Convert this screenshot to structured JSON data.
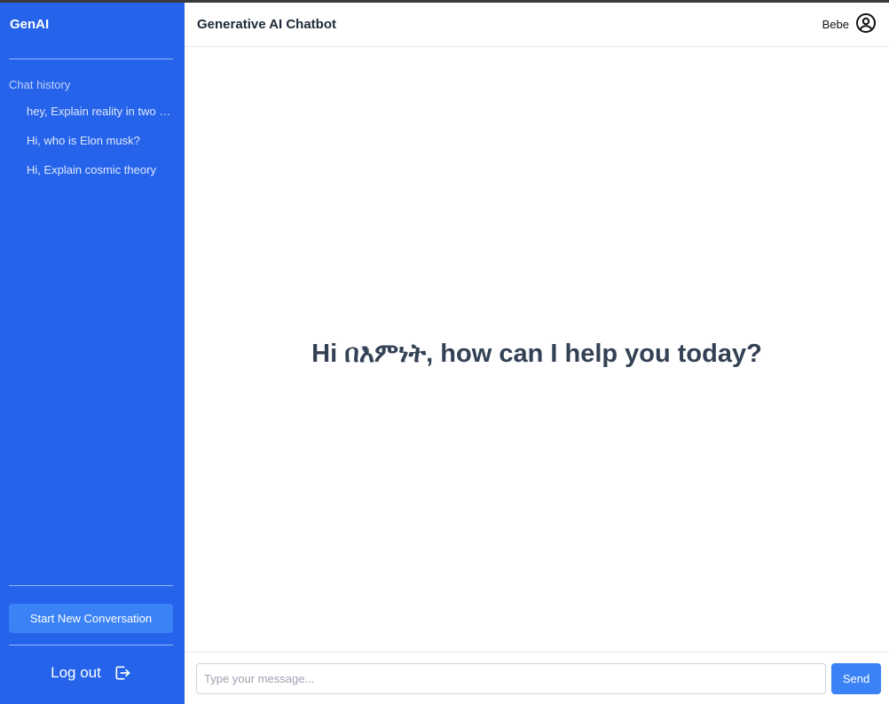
{
  "sidebar": {
    "brand": "GenAI",
    "history_title": "Chat history",
    "history": [
      "hey, Explain reality in two lines",
      "Hi, who is Elon musk?",
      "Hi, Explain cosmic theory"
    ],
    "new_conversation_label": "Start New Conversation",
    "logout_label": "Log out"
  },
  "header": {
    "title": "Generative AI Chatbot",
    "username": "Bebe"
  },
  "main": {
    "greeting": "Hi በእምነት, how can I help you today?"
  },
  "composer": {
    "placeholder": "Type your message...",
    "send_label": "Send"
  },
  "icons": {
    "user": "user-circle-icon",
    "logout": "logout-icon"
  },
  "colors": {
    "sidebar_bg": "#2563eb",
    "accent": "#3b82f6",
    "greeting_text": "#334155"
  }
}
